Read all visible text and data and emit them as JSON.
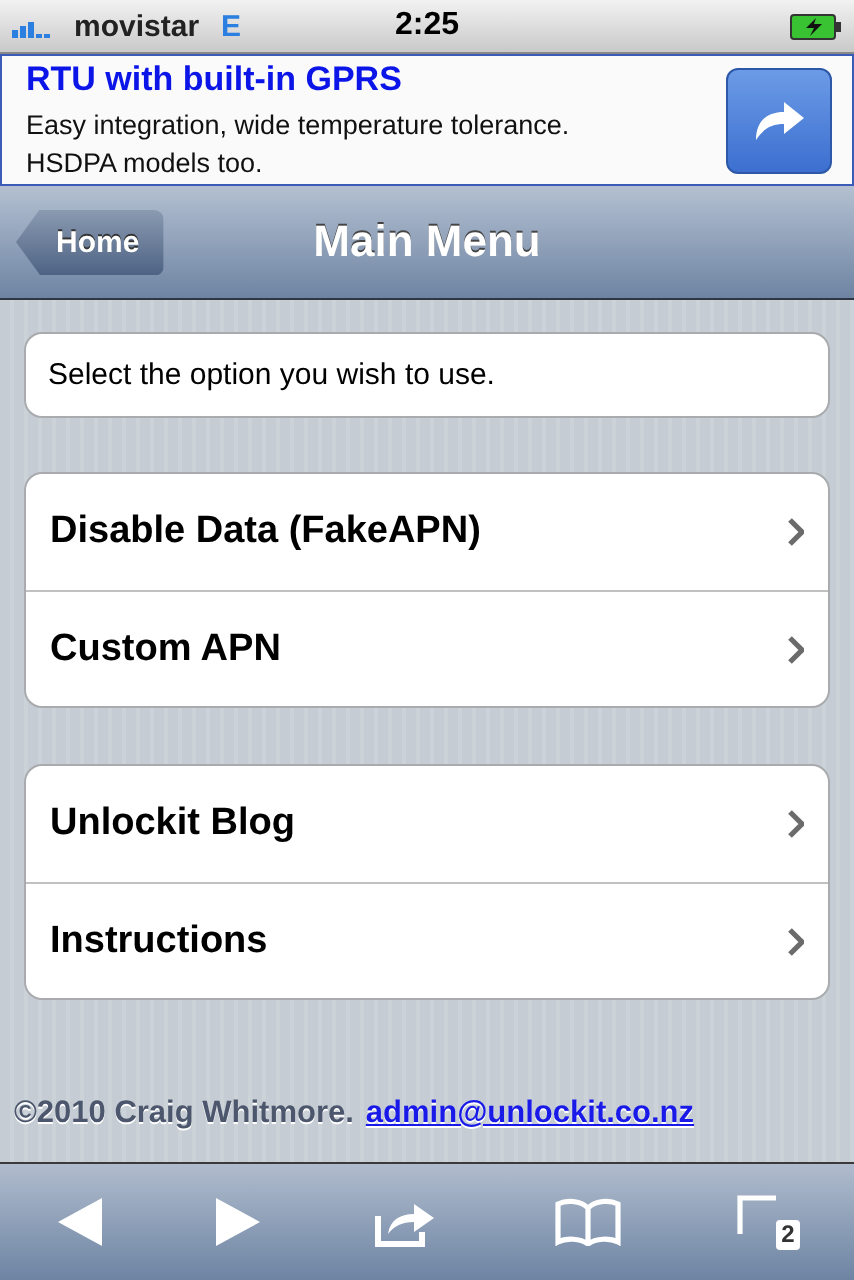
{
  "status_bar": {
    "carrier": "movistar",
    "network": "E",
    "time": "2:25"
  },
  "ad": {
    "title": "RTU with built-in GPRS",
    "text": "Easy integration, wide temperature tolerance. HSDPA models too."
  },
  "nav_bar": {
    "back": "Home",
    "title": "Main Menu"
  },
  "intro": "Select the option you wish to use.",
  "groups": [
    {
      "items": [
        {
          "label": "Disable Data (FakeAPN)"
        },
        {
          "label": "Custom APN"
        }
      ]
    },
    {
      "items": [
        {
          "label": "Unlockit Blog"
        },
        {
          "label": "Instructions"
        }
      ]
    }
  ],
  "footer": {
    "copyright": "©2010 Craig Whitmore.",
    "email": "admin@unlockit.co.nz"
  },
  "toolbar": {
    "tab_count": "2"
  }
}
